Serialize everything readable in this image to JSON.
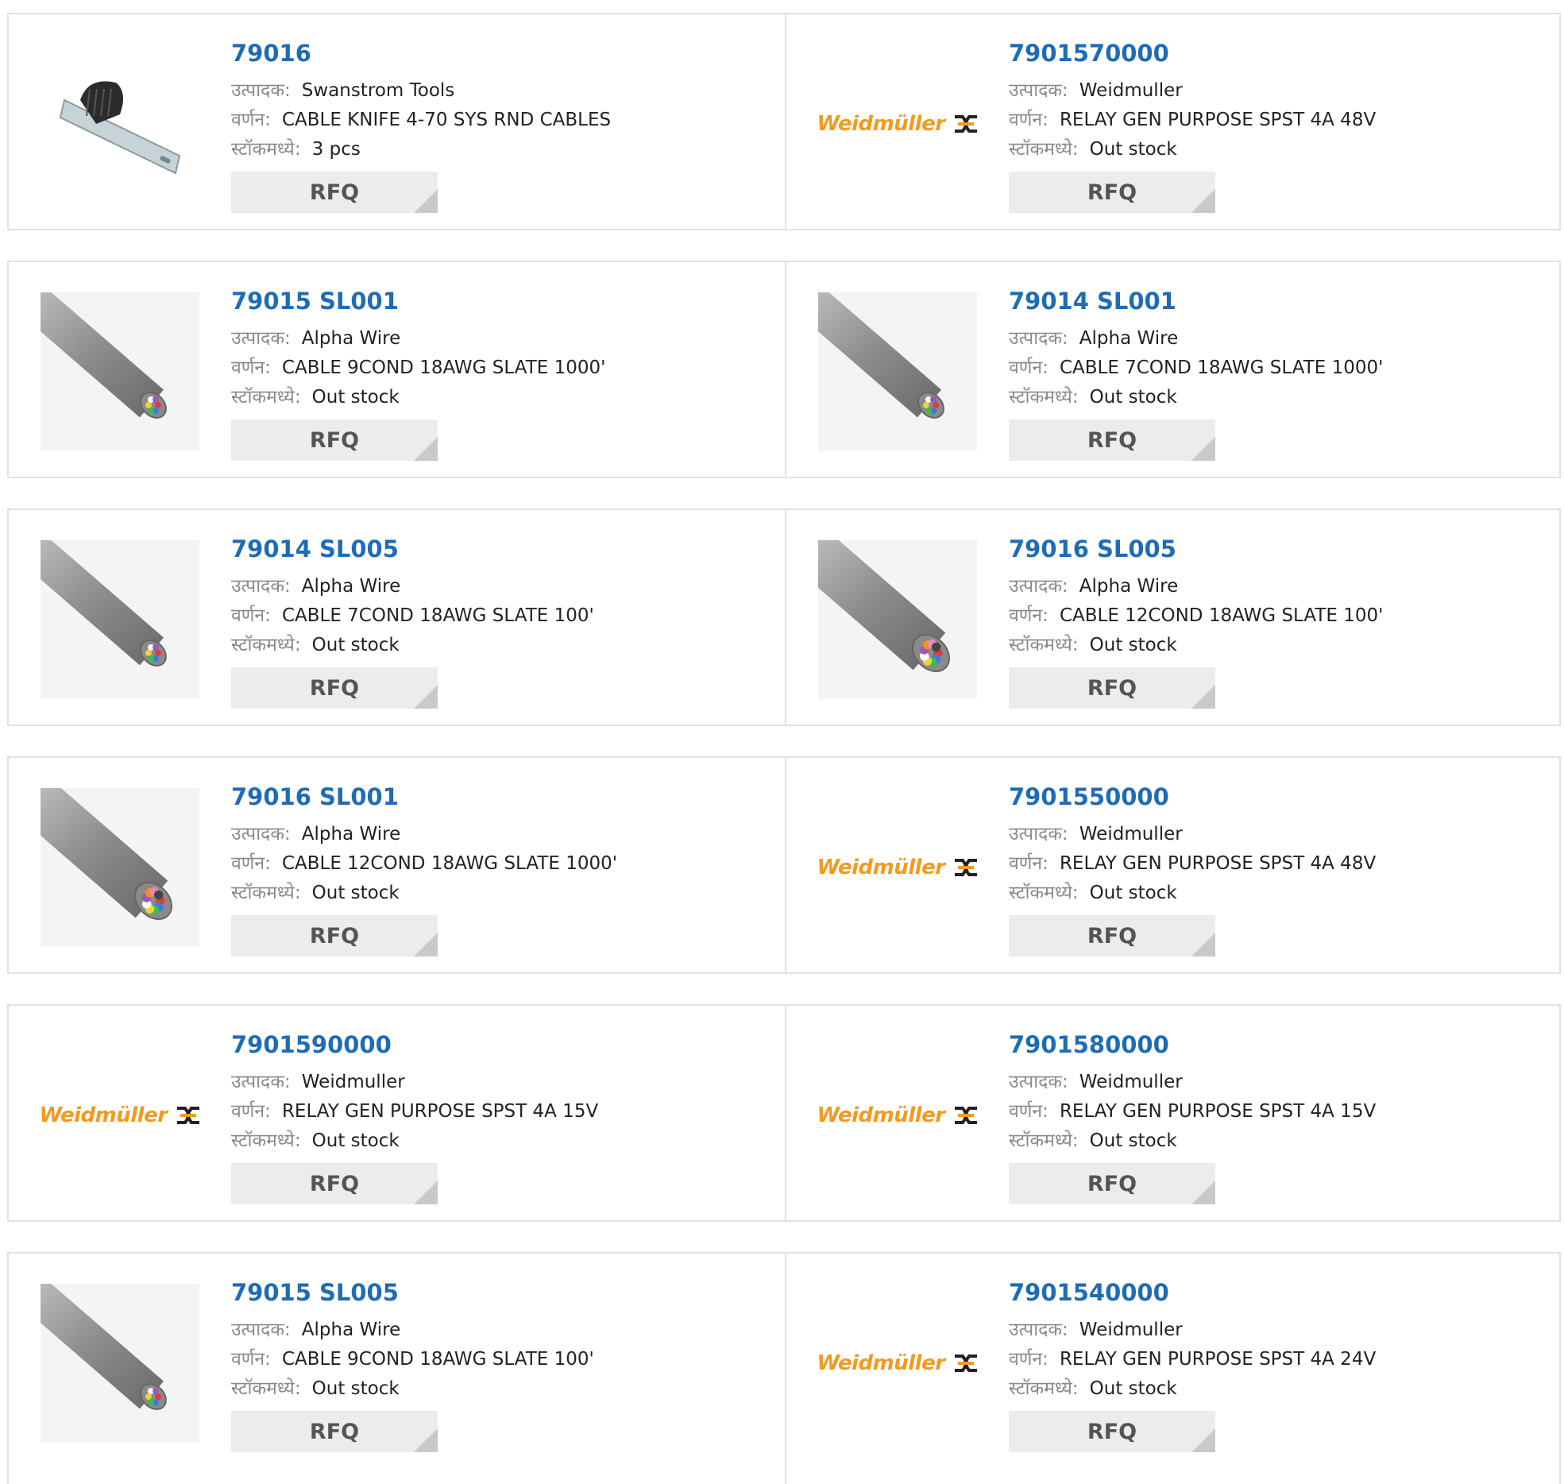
{
  "labels": {
    "manufacturer": "उत्पादक:",
    "description": "वर्णन:",
    "stock": "स्टॉकमध्ये:"
  },
  "rfq_label": "RFQ",
  "products": [
    {
      "part": "79016",
      "manufacturer": "Swanstrom Tools",
      "description": "CABLE KNIFE 4-70 SYS RND CABLES",
      "stock": "3 pcs",
      "image": "cable-knife"
    },
    {
      "part": "7901570000",
      "manufacturer": "Weidmuller",
      "description": "RELAY GEN PURPOSE SPST 4A 48V",
      "stock": "Out stock",
      "image": "weidmuller-logo"
    },
    {
      "part": "79015 SL001",
      "manufacturer": "Alpha Wire",
      "description": "CABLE 9COND 18AWG SLATE 1000'",
      "stock": "Out stock",
      "image": "cable-small"
    },
    {
      "part": "79014 SL001",
      "manufacturer": "Alpha Wire",
      "description": "CABLE 7COND 18AWG SLATE 1000'",
      "stock": "Out stock",
      "image": "cable-small"
    },
    {
      "part": "79014 SL005",
      "manufacturer": "Alpha Wire",
      "description": "CABLE 7COND 18AWG SLATE 100'",
      "stock": "Out stock",
      "image": "cable-small"
    },
    {
      "part": "79016 SL005",
      "manufacturer": "Alpha Wire",
      "description": "CABLE 12COND 18AWG SLATE 100'",
      "stock": "Out stock",
      "image": "cable-large"
    },
    {
      "part": "79016 SL001",
      "manufacturer": "Alpha Wire",
      "description": "CABLE 12COND 18AWG SLATE 1000'",
      "stock": "Out stock",
      "image": "cable-large"
    },
    {
      "part": "7901550000",
      "manufacturer": "Weidmuller",
      "description": "RELAY GEN PURPOSE SPST 4A 48V",
      "stock": "Out stock",
      "image": "weidmuller-logo"
    },
    {
      "part": "7901590000",
      "manufacturer": "Weidmuller",
      "description": "RELAY GEN PURPOSE SPST 4A 15V",
      "stock": "Out stock",
      "image": "weidmuller-logo"
    },
    {
      "part": "7901580000",
      "manufacturer": "Weidmuller",
      "description": "RELAY GEN PURPOSE SPST 4A 15V",
      "stock": "Out stock",
      "image": "weidmuller-logo"
    },
    {
      "part": "79015 SL005",
      "manufacturer": "Alpha Wire",
      "description": "CABLE 9COND 18AWG SLATE 100'",
      "stock": "Out stock",
      "image": "cable-small"
    },
    {
      "part": "7901540000",
      "manufacturer": "Weidmuller",
      "description": "RELAY GEN PURPOSE SPST 4A 24V",
      "stock": "Out stock",
      "image": "weidmuller-logo"
    }
  ],
  "logo_text": "Weidmüller",
  "colors": {
    "link": "#1e6cb5",
    "label": "#8a8a8a",
    "button_bg": "#ececec",
    "border": "#e2e2e2",
    "logo": "#f39a1e"
  }
}
